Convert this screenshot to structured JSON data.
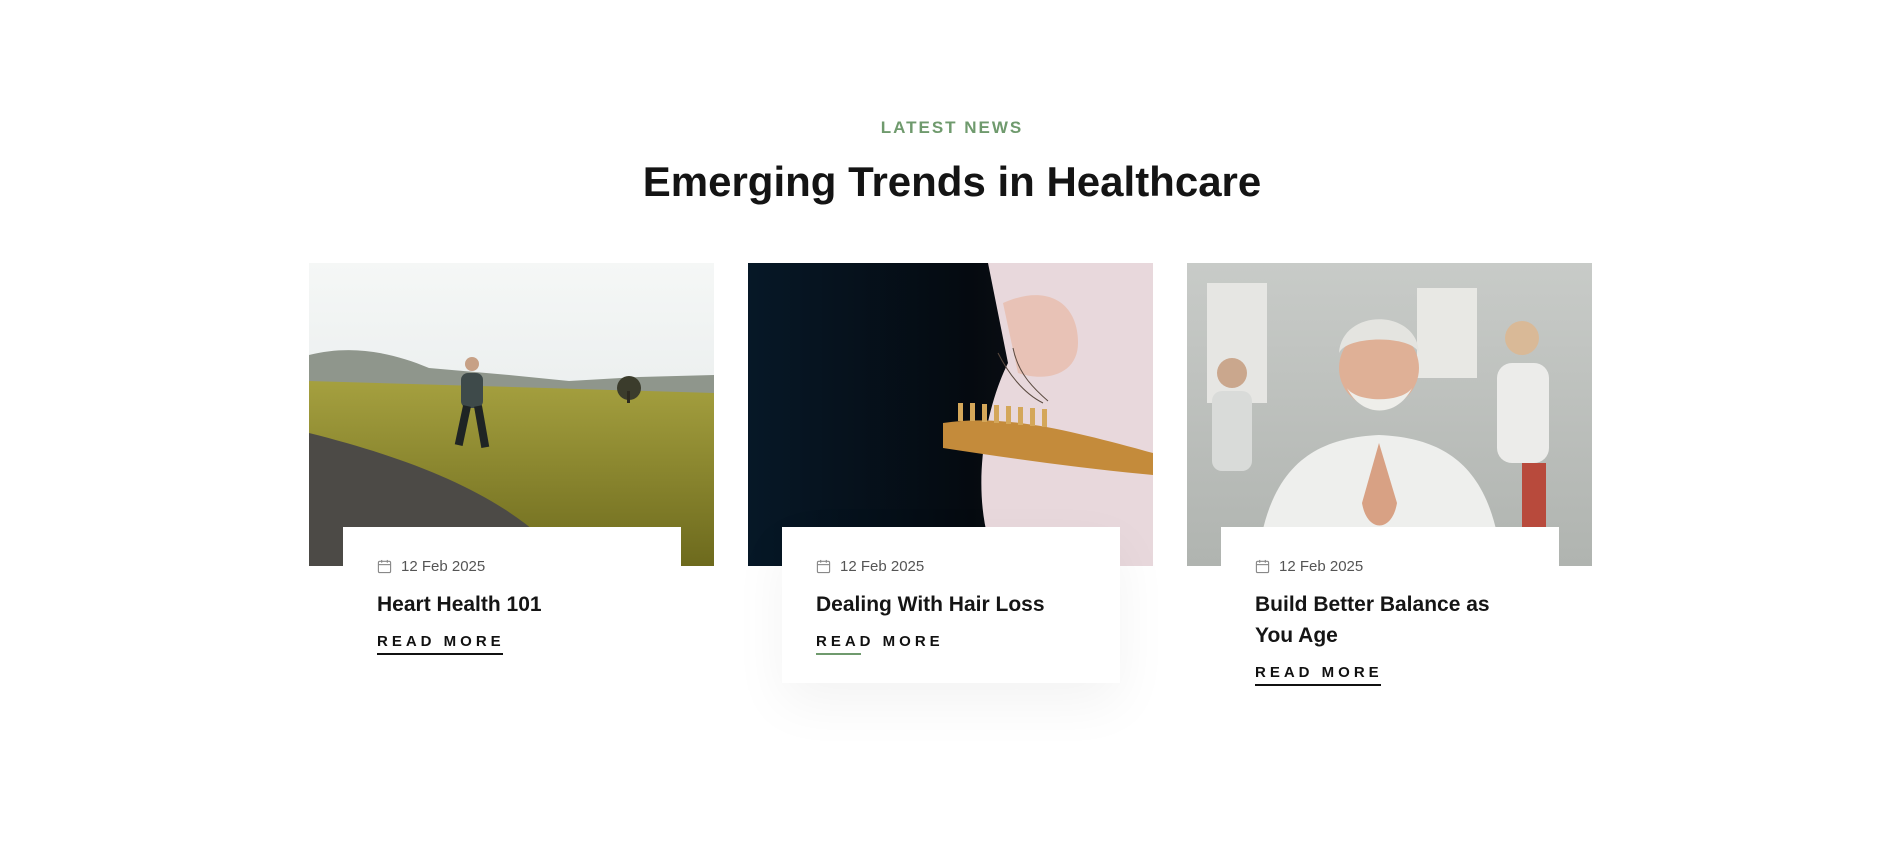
{
  "section": {
    "eyebrow": "LATEST NEWS",
    "heading": "Emerging Trends in Healthcare"
  },
  "posts": [
    {
      "image_alt": "Man running on a rural road at sunrise",
      "date": "12 Feb 2025",
      "title": "Heart Health 101",
      "cta": "READ MORE"
    },
    {
      "image_alt": "Hand holding a wooden hairbrush with shed hair",
      "date": "12 Feb 2025",
      "title": "Dealing With Hair Loss",
      "cta": "READ MORE"
    },
    {
      "image_alt": "Smiling senior man in a yoga class with hands together",
      "date": "12 Feb 2025",
      "title": "Build Better Balance as You Age",
      "cta": "READ MORE"
    }
  ],
  "colors": {
    "accent": "#6f9a6d",
    "heading": "#141414",
    "meta": "#555555"
  },
  "icons": {
    "date": "calendar-icon"
  }
}
